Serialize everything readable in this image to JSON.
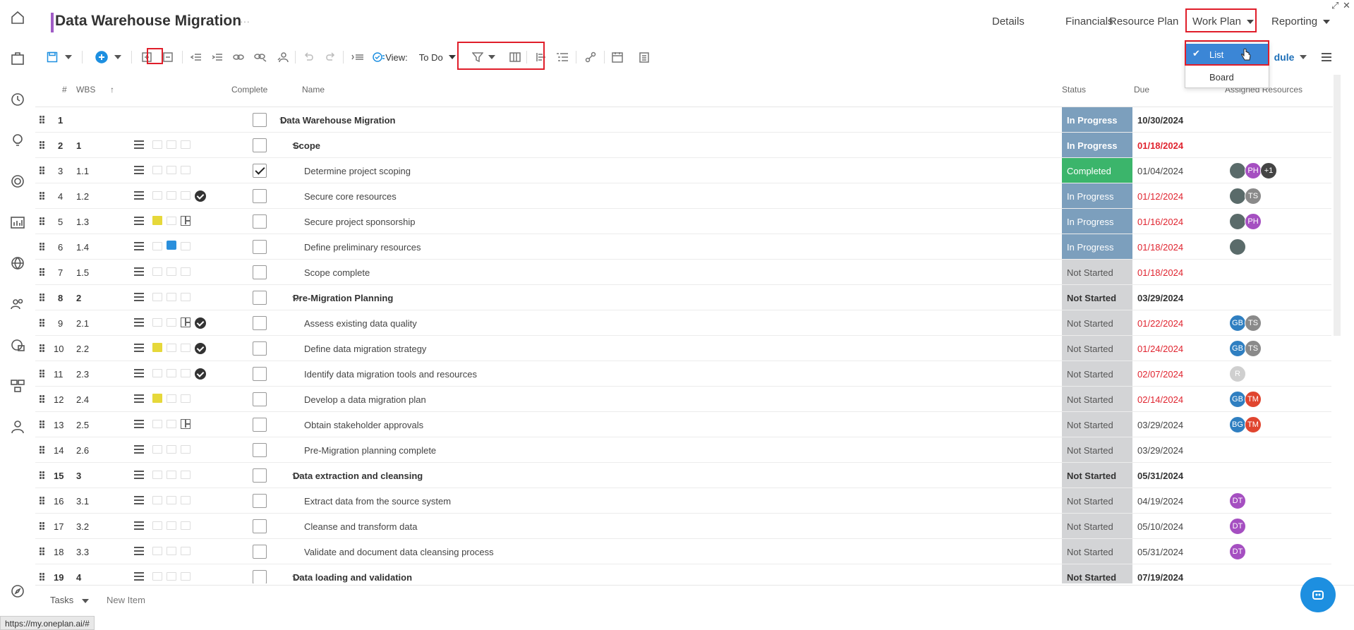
{
  "header": {
    "title": "Data Warehouse Migration",
    "more": "···",
    "nav": [
      "Details",
      "Financials",
      "Resource Plan",
      "Work Plan",
      "Reporting"
    ],
    "schedule_partial": "dule"
  },
  "toolbar": {
    "view_label": "View:",
    "view_value": "To Do"
  },
  "workplan_dropdown": {
    "items": [
      "List",
      "Board"
    ],
    "selected": "List"
  },
  "grid": {
    "columns": {
      "num": "#",
      "wbs": "WBS",
      "complete": "Complete",
      "name": "Name",
      "status": "Status",
      "due": "Due",
      "assigned": "Assigned Resources"
    },
    "rows": [
      {
        "num": "1",
        "wbs": "",
        "name": "Data Warehouse Migration",
        "status": "In Progress",
        "due": "10/30/2024",
        "level": 0,
        "summary": true,
        "checked": false,
        "avatars": []
      },
      {
        "num": "2",
        "wbs": "1",
        "name": "Scope",
        "status": "In Progress",
        "due": "01/18/2024",
        "level": 1,
        "summary": true,
        "checked": false,
        "avatars": []
      },
      {
        "num": "3",
        "wbs": "1.1",
        "name": "Determine project scoping",
        "status": "Completed",
        "due": "01/04/2024",
        "level": 2,
        "summary": false,
        "checked": true,
        "avatars": [
          {
            "t": "",
            "c": "#5a6b6a"
          },
          {
            "t": "PH",
            "c": "#a54fc1"
          },
          {
            "t": "+1",
            "c": "#444444"
          }
        ]
      },
      {
        "num": "4",
        "wbs": "1.2",
        "name": "Secure core resources",
        "status": "In Progress",
        "due": "01/12/2024",
        "level": 2,
        "summary": false,
        "checked": false,
        "avatars": [
          {
            "t": "",
            "c": "#5a6b6a"
          },
          {
            "t": "TS",
            "c": "#8a8a8a"
          }
        ]
      },
      {
        "num": "5",
        "wbs": "1.3",
        "name": "Secure project sponsorship",
        "status": "In Progress",
        "due": "01/16/2024",
        "level": 2,
        "summary": false,
        "checked": false,
        "avatars": [
          {
            "t": "",
            "c": "#5a6b6a"
          },
          {
            "t": "PH",
            "c": "#a54fc1"
          }
        ]
      },
      {
        "num": "6",
        "wbs": "1.4",
        "name": "Define preliminary resources",
        "status": "In Progress",
        "due": "01/18/2024",
        "level": 2,
        "summary": false,
        "checked": false,
        "avatars": [
          {
            "t": "",
            "c": "#5a6b6a"
          }
        ]
      },
      {
        "num": "7",
        "wbs": "1.5",
        "name": "Scope complete",
        "status": "Not Started",
        "due": "01/18/2024",
        "level": 2,
        "summary": false,
        "checked": false,
        "avatars": []
      },
      {
        "num": "8",
        "wbs": "2",
        "name": "Pre-Migration Planning",
        "status": "Not Started",
        "due": "03/29/2024",
        "level": 1,
        "summary": true,
        "checked": false,
        "avatars": []
      },
      {
        "num": "9",
        "wbs": "2.1",
        "name": "Assess existing data quality",
        "status": "Not Started",
        "due": "01/22/2024",
        "level": 2,
        "summary": false,
        "checked": false,
        "avatars": [
          {
            "t": "GB",
            "c": "#2f7fc1"
          },
          {
            "t": "TS",
            "c": "#8a8a8a"
          }
        ]
      },
      {
        "num": "10",
        "wbs": "2.2",
        "name": "Define data migration strategy",
        "status": "Not Started",
        "due": "01/24/2024",
        "level": 2,
        "summary": false,
        "checked": false,
        "avatars": [
          {
            "t": "GB",
            "c": "#2f7fc1"
          },
          {
            "t": "TS",
            "c": "#8a8a8a"
          }
        ]
      },
      {
        "num": "11",
        "wbs": "2.3",
        "name": "Identify data migration tools and resources",
        "status": "Not Started",
        "due": "02/07/2024",
        "level": 2,
        "summary": false,
        "checked": false,
        "avatars": [
          {
            "t": "R",
            "c": "#cfcfcf"
          }
        ]
      },
      {
        "num": "12",
        "wbs": "2.4",
        "name": "Develop a data migration plan",
        "status": "Not Started",
        "due": "02/14/2024",
        "level": 2,
        "summary": false,
        "checked": false,
        "avatars": [
          {
            "t": "GB",
            "c": "#2f7fc1"
          },
          {
            "t": "TM",
            "c": "#e0452f"
          }
        ]
      },
      {
        "num": "13",
        "wbs": "2.5",
        "name": "Obtain stakeholder approvals",
        "status": "Not Started",
        "due": "03/29/2024",
        "level": 2,
        "summary": false,
        "checked": false,
        "avatars": [
          {
            "t": "BG",
            "c": "#2f7fc1"
          },
          {
            "t": "TM",
            "c": "#e0452f"
          }
        ]
      },
      {
        "num": "14",
        "wbs": "2.6",
        "name": "Pre-Migration planning complete",
        "status": "Not Started",
        "due": "03/29/2024",
        "level": 2,
        "summary": false,
        "checked": false,
        "avatars": []
      },
      {
        "num": "15",
        "wbs": "3",
        "name": "Data extraction and cleansing",
        "status": "Not Started",
        "due": "05/31/2024",
        "level": 1,
        "summary": true,
        "checked": false,
        "avatars": []
      },
      {
        "num": "16",
        "wbs": "3.1",
        "name": "Extract data from the source system",
        "status": "Not Started",
        "due": "04/19/2024",
        "level": 2,
        "summary": false,
        "checked": false,
        "avatars": [
          {
            "t": "DT",
            "c": "#a54fc1"
          }
        ]
      },
      {
        "num": "17",
        "wbs": "3.2",
        "name": "Cleanse and transform data",
        "status": "Not Started",
        "due": "05/10/2024",
        "level": 2,
        "summary": false,
        "checked": false,
        "avatars": [
          {
            "t": "DT",
            "c": "#a54fc1"
          }
        ]
      },
      {
        "num": "18",
        "wbs": "3.3",
        "name": "Validate and document data cleansing process",
        "status": "Not Started",
        "due": "05/31/2024",
        "level": 2,
        "summary": false,
        "checked": false,
        "avatars": [
          {
            "t": "DT",
            "c": "#a54fc1"
          }
        ]
      },
      {
        "num": "19",
        "wbs": "4",
        "name": "Data loading and validation",
        "status": "Not Started",
        "due": "07/19/2024",
        "level": 1,
        "summary": true,
        "checked": false,
        "avatars": []
      }
    ]
  },
  "row_icons": {
    "4": [
      "done"
    ],
    "5": [
      "note-y",
      "grid"
    ],
    "6": [
      "note-b"
    ],
    "9": [
      "grid",
      "done"
    ],
    "10": [
      "note-y",
      "done"
    ],
    "11": [
      "done"
    ],
    "12": [
      "note-y"
    ],
    "13": [
      "grid"
    ]
  },
  "red_due_rows": [
    "2",
    "4",
    "5",
    "6",
    "7",
    "9",
    "10",
    "11",
    "12"
  ],
  "bottom": {
    "tasks_label": "Tasks",
    "new_item": "New Item"
  },
  "status_url": "https://my.oneplan.ai/#",
  "colors": {
    "in_progress": "#7c9fbd",
    "completed": "#3bb56b",
    "not_started": "#d3d4d6",
    "overdue": "#e0242f",
    "accent": "#1d8fe0",
    "highlight_box": "#e01e2a",
    "title_bar": "#a05cc6"
  }
}
